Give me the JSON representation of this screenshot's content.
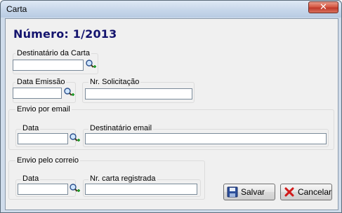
{
  "window": {
    "title": "Carta",
    "close_glyph": "✕"
  },
  "heading": "Número: 1/2013",
  "fields": {
    "destinatario_carta": {
      "label": "Destinatário da Carta",
      "value": ""
    },
    "data_emissao": {
      "label": "Data Emissão",
      "value": ""
    },
    "nr_solicitacao": {
      "label": "Nr. Solicitação",
      "value": ""
    }
  },
  "envio_email": {
    "group_label": "Envio por email",
    "data": {
      "label": "Data",
      "value": ""
    },
    "destinatario_email": {
      "label": "Destinatário email",
      "value": ""
    }
  },
  "envio_correio": {
    "group_label": "Envio pelo correio",
    "data": {
      "label": "Data",
      "value": ""
    },
    "nr_carta_registrada": {
      "label": "Nr. carta registrada",
      "value": ""
    }
  },
  "buttons": {
    "salvar": "Salvar",
    "cancelar": "Cancelar"
  },
  "icons": {
    "search": "search-add-icon",
    "save": "floppy-disk-icon",
    "cancel": "red-x-icon"
  },
  "colors": {
    "heading": "#14146e",
    "cancel_x": "#d11a1a",
    "close_button": "#c0392b"
  }
}
